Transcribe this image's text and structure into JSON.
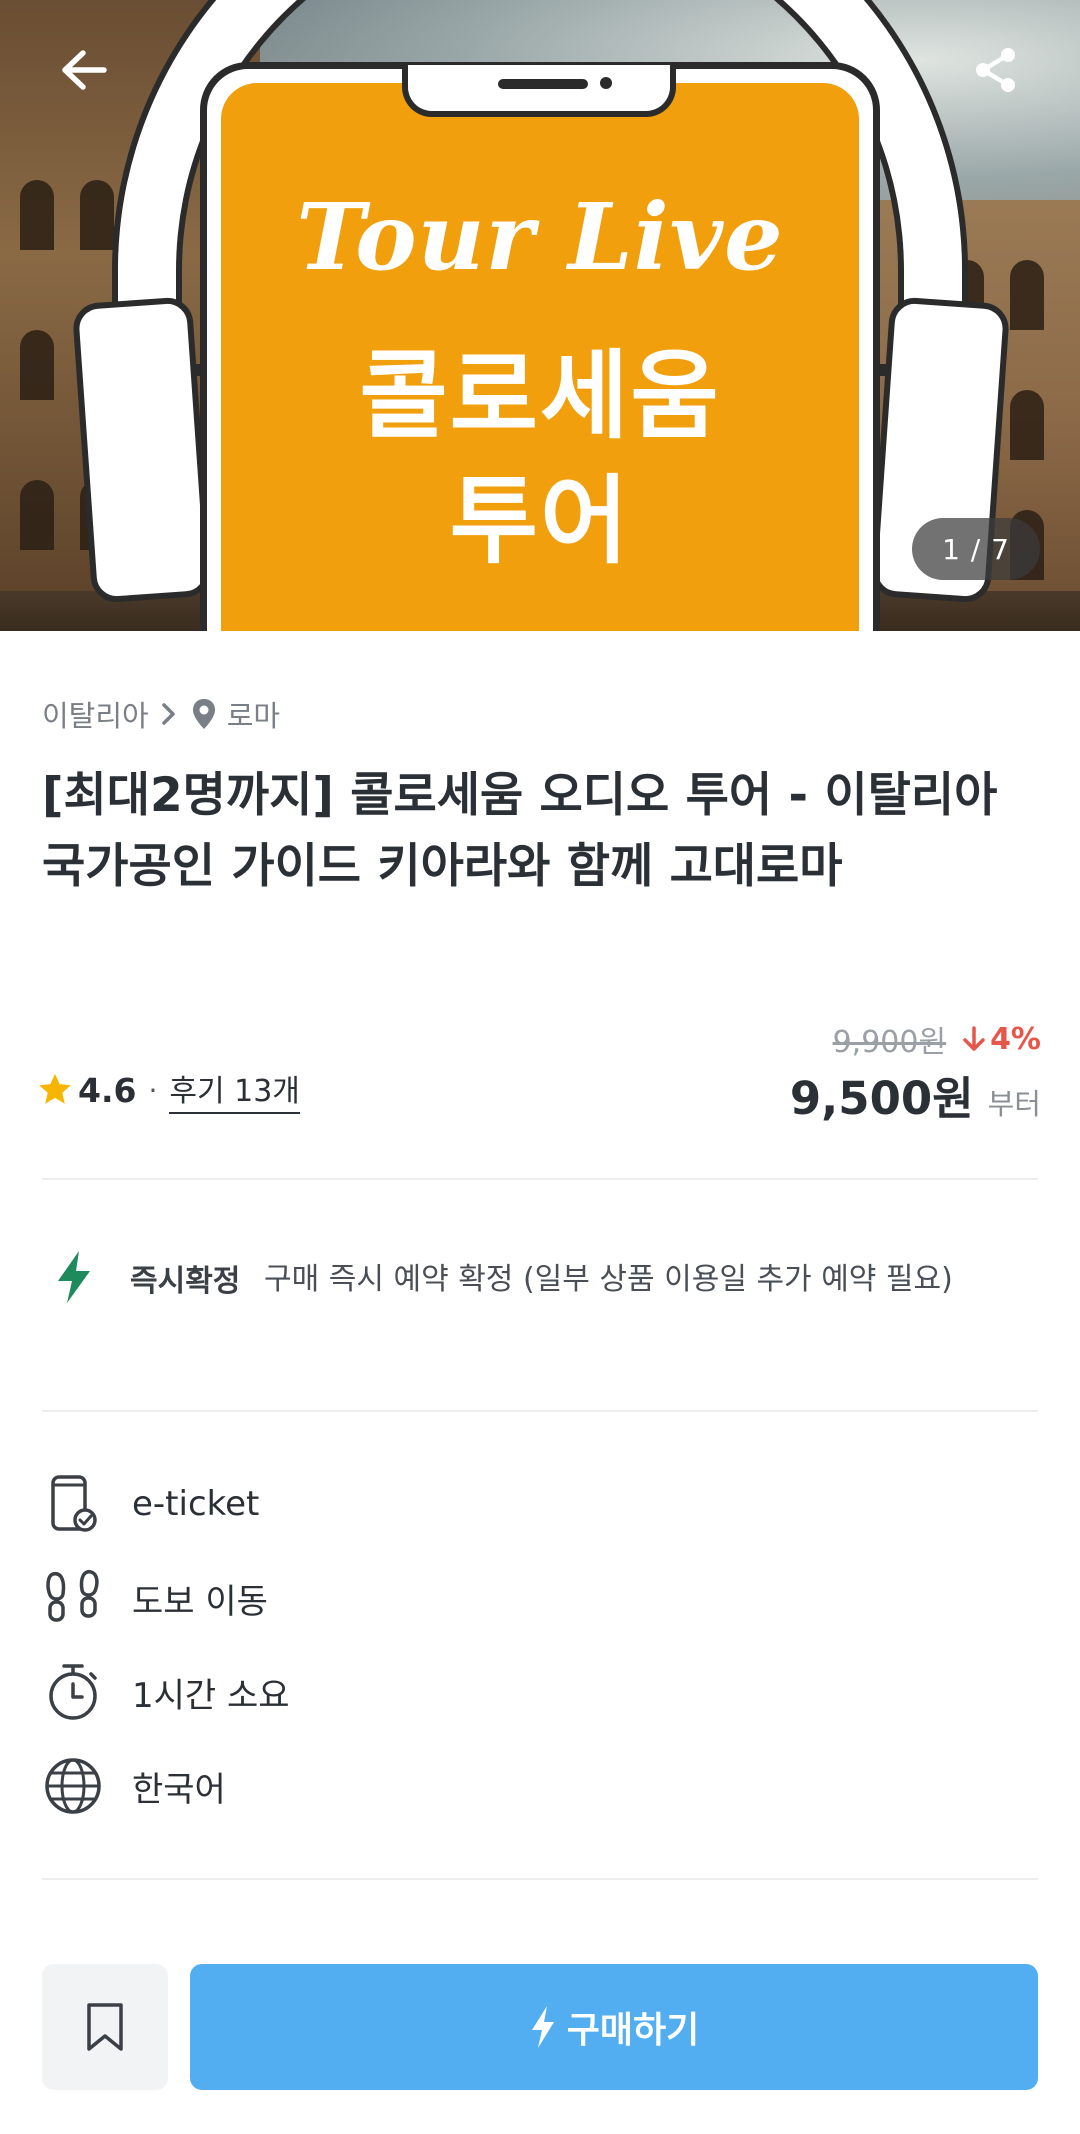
{
  "hero": {
    "brand": "Tour Live",
    "line1": "콜로세움",
    "line2": "투어",
    "counter": "1 / 7"
  },
  "breadcrumb": {
    "country": "이탈리아",
    "city": "로마"
  },
  "product": {
    "title": "[최대2명까지] 콜로세움 오디오 투어 - 이탈리아 국가공인 가이드 키아라와 함께 고대로마",
    "rating": "4.6",
    "separator": "·",
    "reviews": "후기 13개",
    "original_price": "9,900원",
    "discount": "4%",
    "price": "9,500원",
    "price_suffix": "부터"
  },
  "instant": {
    "label": "즉시확정",
    "description": "구매 즉시 예약 확정 (일부 상품 이용일 추가 예약 필요)"
  },
  "features": [
    {
      "icon": "mobile-ticket-icon",
      "label": "e-ticket"
    },
    {
      "icon": "footprints-icon",
      "label": "도보 이동"
    },
    {
      "icon": "stopwatch-icon",
      "label": "1시간 소요"
    },
    {
      "icon": "globe-icon",
      "label": "한국어"
    }
  ],
  "actions": {
    "buy_label": "구매하기"
  },
  "colors": {
    "accent_blue": "#52aef0",
    "discount_red": "#e6574a",
    "instant_green": "#1f8a5b",
    "hero_orange": "#f19f0d",
    "star_yellow": "#f7b500"
  }
}
